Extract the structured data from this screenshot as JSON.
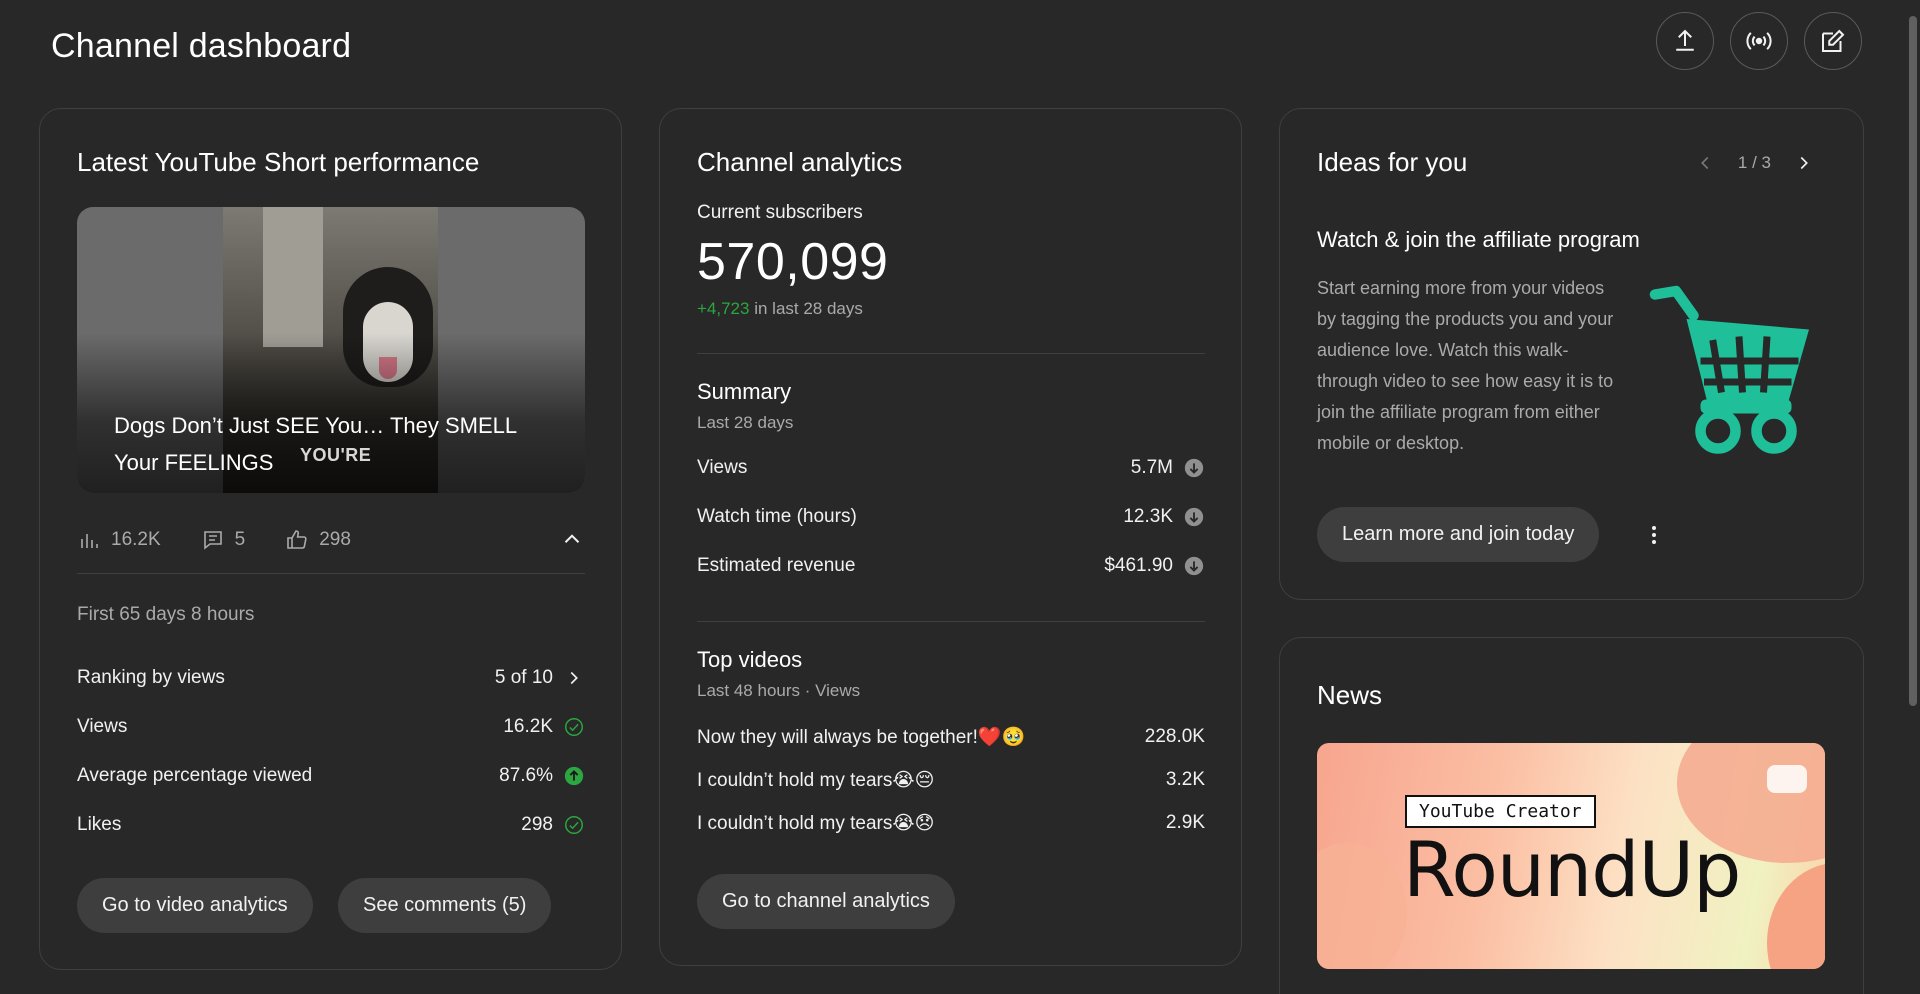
{
  "header": {
    "title": "Channel dashboard",
    "actions": [
      {
        "icon": "upload-icon"
      },
      {
        "icon": "live-broadcast-icon"
      },
      {
        "icon": "create-post-icon"
      }
    ]
  },
  "short_card": {
    "title": "Latest YouTube Short performance",
    "thumbnail_title": "Dogs Don’t Just SEE You… They SMELL Your FEELINGS",
    "thumbnail_sticker": "YOU'RE",
    "stats": {
      "views": "16.2K",
      "comments": "5",
      "likes": "298"
    },
    "period": "First 65 days 8 hours",
    "metrics": [
      {
        "label": "Ranking by views",
        "value": "5 of 10",
        "indicator": "chevron-right-icon"
      },
      {
        "label": "Views",
        "value": "16.2K",
        "indicator": "check-circle-icon"
      },
      {
        "label": "Average percentage viewed",
        "value": "87.6%",
        "indicator": "arrow-up-circle-icon"
      },
      {
        "label": "Likes",
        "value": "298",
        "indicator": "check-circle-icon"
      }
    ],
    "buttons": {
      "analytics": "Go to video analytics",
      "comments": "See comments (5)"
    }
  },
  "analytics_card": {
    "title": "Channel analytics",
    "subs_label": "Current subscribers",
    "subs_value": "570,099",
    "subs_delta": "+4,723",
    "subs_delta_suffix": " in last 28 days",
    "summary": {
      "title": "Summary",
      "period": "Last 28 days",
      "rows": [
        {
          "label": "Views",
          "value": "5.7M"
        },
        {
          "label": "Watch time (hours)",
          "value": "12.3K"
        },
        {
          "label": "Estimated revenue",
          "value": "$461.90"
        }
      ]
    },
    "top_videos": {
      "title": "Top videos",
      "period": "Last 48 hours · Views",
      "rows": [
        {
          "label": "Now they will always be together!❤️🥹",
          "value": "228.0K"
        },
        {
          "label": "I couldn’t hold my tears😭😔",
          "value": "3.2K"
        },
        {
          "label": "I couldn’t hold my tears😭😞",
          "value": "2.9K"
        }
      ]
    },
    "button": "Go to channel analytics"
  },
  "ideas_card": {
    "title": "Ideas for you",
    "pager": "1 / 3",
    "idea_title": "Watch & join the affiliate program",
    "idea_body": "Start earning more from your videos by tagging the products you and your audience love. Watch this walk-through video to see how easy it is to join the affiliate program from either mobile or desktop.",
    "button": "Learn more and join today",
    "accent": "#1fbf9a"
  },
  "news_card": {
    "title": "News",
    "image_tag": "YouTube Creator",
    "image_headline": "RoundUp"
  }
}
